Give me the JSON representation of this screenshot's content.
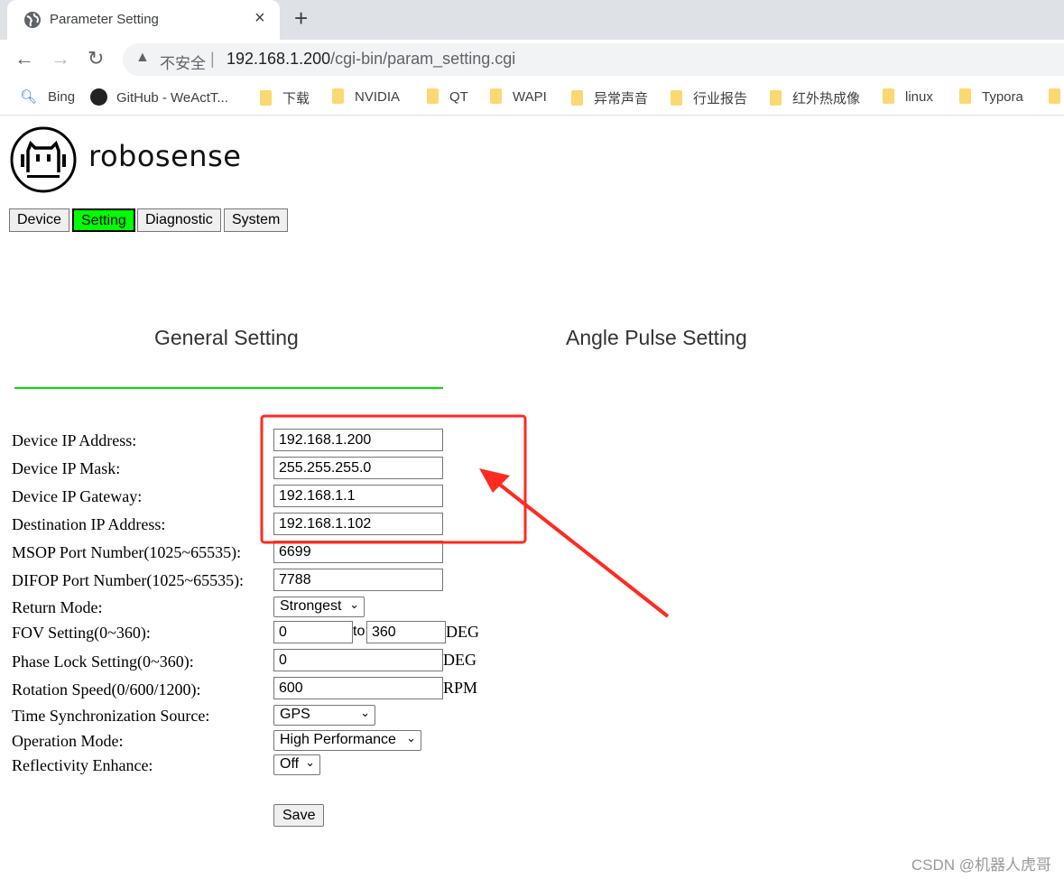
{
  "browser": {
    "tab_title": "Parameter Setting",
    "close_tab": "×",
    "new_tab": "+",
    "security_label": "不安全",
    "url_host": "192.168.1.200",
    "url_path": "/cgi-bin/param_setting.cgi",
    "bookmarks": [
      "Bing",
      "GitHub - WeActT...",
      "下载",
      "NVIDIA",
      "QT",
      "WAPI",
      "异常声音",
      "行业报告",
      "红外热成像",
      "linux",
      "Typora"
    ]
  },
  "brand": "robosense",
  "nav": {
    "tabs": [
      "Device",
      "Setting",
      "Diagnostic",
      "System"
    ],
    "active": "Setting",
    "active_color": "#00ff00"
  },
  "sections": {
    "general": "General Setting",
    "angle_pulse": "Angle Pulse Setting",
    "active": "General Setting"
  },
  "form": {
    "device_ip": {
      "label": "Device IP Address:",
      "value": "192.168.1.200"
    },
    "ip_mask": {
      "label": "Device IP Mask:",
      "value": "255.255.255.0"
    },
    "gateway": {
      "label": "Device IP Gateway:",
      "value": "192.168.1.1"
    },
    "dest_ip": {
      "label": "Destination IP Address:",
      "value": "192.168.1.102"
    },
    "msop": {
      "label": "MSOP Port Number(1025~65535):",
      "value": "6699"
    },
    "difop": {
      "label": "DIFOP Port Number(1025~65535):",
      "value": "7788"
    },
    "return_mode": {
      "label": "Return Mode:",
      "value": "Strongest"
    },
    "fov": {
      "label": "FOV Setting(0~360):",
      "start": "0",
      "sep": "to",
      "end": "360",
      "unit": "DEG"
    },
    "phase_lock": {
      "label": "Phase Lock Setting(0~360):",
      "value": "0",
      "unit": "DEG"
    },
    "rotation": {
      "label": "Rotation Speed(0/600/1200):",
      "value": "600",
      "unit": "RPM"
    },
    "time_sync": {
      "label": "Time Synchronization Source:",
      "value": "GPS"
    },
    "operation": {
      "label": "Operation Mode:",
      "value": "High Performance"
    },
    "reflectivity": {
      "label": "Reflectivity Enhance:",
      "value": "Off"
    },
    "save": "Save"
  },
  "annotation_color": "#ff2a20",
  "watermark": "CSDN @机器人虎哥"
}
